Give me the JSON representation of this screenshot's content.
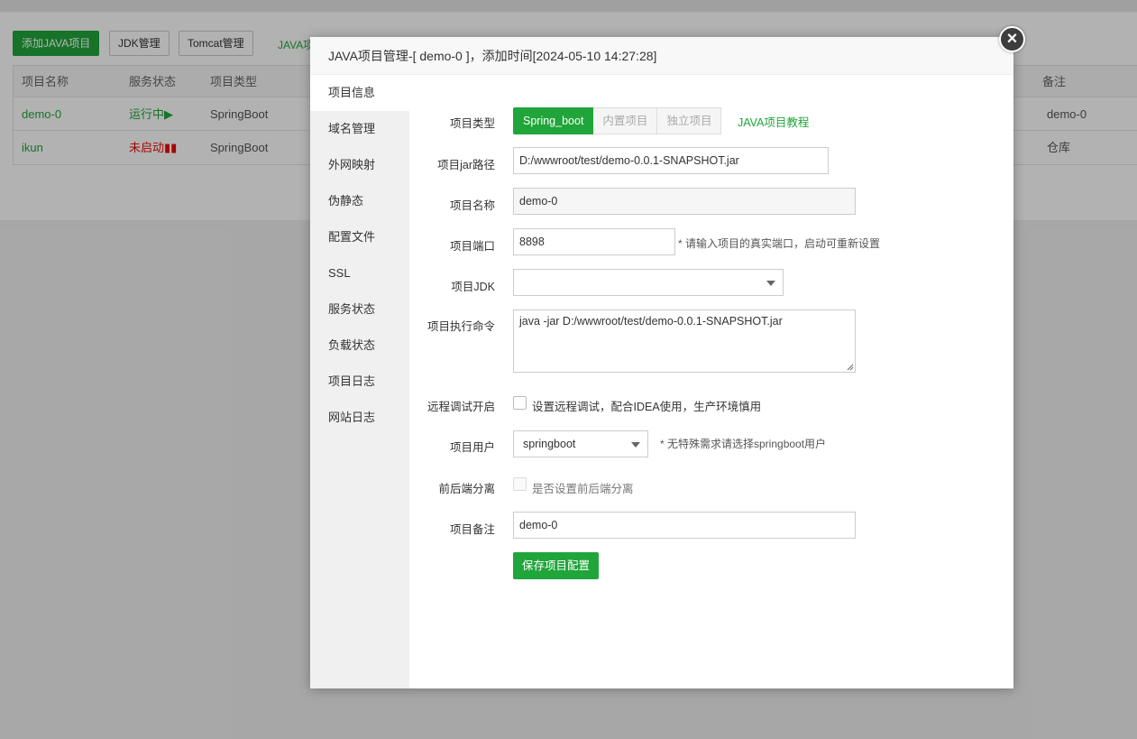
{
  "background": {
    "buttons": {
      "add_java": "添加JAVA项目",
      "jdk": "JDK管理",
      "tomcat": "Tomcat管理"
    },
    "partial_link": "JAVA项",
    "table": {
      "headers": {
        "name": "项目名称",
        "status": "服务状态",
        "type": "项目类型",
        "remark": "备注"
      },
      "rows": [
        {
          "name": "demo-0",
          "status": "运行中▶",
          "type": "SpringBoot",
          "remark": "demo-0"
        },
        {
          "name": "ikun",
          "status": "未启动▮▮",
          "type": "SpringBoot",
          "remark": "仓库"
        }
      ]
    }
  },
  "modal": {
    "title": "JAVA项目管理-[ demo-0 ]，添加时间[2024-05-10 14:27:28]",
    "close_glyph": "×",
    "menu": [
      "项目信息",
      "域名管理",
      "外网映射",
      "伪静态",
      "配置文件",
      "SSL",
      "服务状态",
      "负载状态",
      "项目日志",
      "网站日志"
    ],
    "form": {
      "project_type": {
        "label": "项目类型",
        "options": [
          "Spring_boot",
          "内置项目",
          "独立项目"
        ],
        "tutorial_link": "JAVA项目教程"
      },
      "jar_path": {
        "label": "项目jar路径",
        "value": "D:/wwwroot/test/demo-0.0.1-SNAPSHOT.jar"
      },
      "name": {
        "label": "项目名称",
        "value": "demo-0"
      },
      "port": {
        "label": "项目端口",
        "value": "8898",
        "hint": "* 请输入项目的真实端口，启动可重新设置"
      },
      "jdk": {
        "label": "项目JDK",
        "value": ""
      },
      "command": {
        "label": "项目执行命令",
        "value": "java -jar D:/wwwroot/test/demo-0.0.1-SNAPSHOT.jar"
      },
      "remote_debug": {
        "label": "远程调试开启",
        "text": "设置远程调试，配合IDEA使用，生产环境慎用"
      },
      "user": {
        "label": "项目用户",
        "value": "springboot",
        "hint": "* 无特殊需求请选择springboot用户"
      },
      "separation": {
        "label": "前后端分离",
        "text": "是否设置前后端分离"
      },
      "remark": {
        "label": "项目备注",
        "value": "demo-0"
      },
      "save_label": "保存项目配置"
    }
  },
  "colors": {
    "accent": "#20a53a",
    "danger": "#ef0808"
  }
}
